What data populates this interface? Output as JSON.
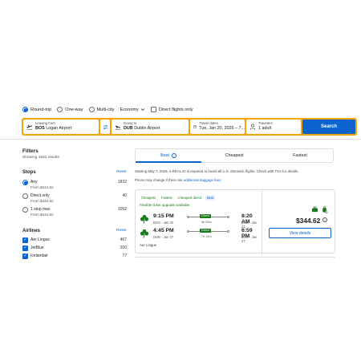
{
  "trip_types": {
    "round_trip": "Round-trip",
    "one_way": "One-way",
    "multi_city": "Multi-city",
    "cabin": "Economy",
    "direct_only": "Direct flights only"
  },
  "search": {
    "from_label": "Leaving from",
    "from_code": "BOS",
    "from_name": "Logan Airport",
    "to_label": "Going to",
    "to_code": "DUB",
    "to_name": "Dublin Airport",
    "dates_label": "Travel dates",
    "dates_value": "Tue, Jan 20, 2026 – 7...",
    "travelers_label": "Travelers",
    "travelers_value": "1 adult",
    "button": "Search"
  },
  "filters": {
    "title": "Filters",
    "count": "Showing 1832 results",
    "stops": {
      "title": "Stops",
      "reset": "Reset",
      "items": [
        {
          "name": "Any",
          "sub": "From $344.62",
          "count": "1832"
        },
        {
          "name": "Direct only",
          "sub": "From $344.62",
          "count": "40"
        },
        {
          "name": "1 stop max",
          "sub": "From $344.62",
          "count": "1052"
        }
      ]
    },
    "airlines": {
      "title": "Airlines",
      "reset": "Reset",
      "items": [
        {
          "name": "Aer Lingus",
          "count": "467"
        },
        {
          "name": "JetBlue",
          "count": "200"
        },
        {
          "name": "Icelandair",
          "count": "77"
        }
      ]
    }
  },
  "sort": {
    "tabs": [
      "Best",
      "Cheapest",
      "Fastest"
    ],
    "active": "Best"
  },
  "notices": {
    "real_id": "Starting May 7, 2025, a REAL ID is required to board all U.S. domestic flights. Check with TSA for details.",
    "baggage_prefix": "Prices may change if there are",
    "baggage_link": "additional baggage fees"
  },
  "flight": {
    "tags": [
      "Cheapest",
      "Fastest",
      "Cheapest direct",
      "Best"
    ],
    "flexible": "Flexible ticket upgrade available",
    "legs": [
      {
        "dep_time": "9:15 PM",
        "dep_sub": "BOS - Jan 20",
        "stops": "Direct",
        "duration": "6h 05m",
        "arr_time": "8:20 AM",
        "arr_sub": "DUB - Jan 21"
      },
      {
        "dep_time": "4:45 PM",
        "dep_sub": "DUB - Jan 27",
        "stops": "Direct",
        "duration": "7h 14m",
        "arr_time": "6:59 PM",
        "arr_sub": "BOS - Jan 27"
      }
    ],
    "airline": "Aer Lingus",
    "price": "$344.62",
    "view_button": "View details",
    "icons": [
      "carry-on-bag-icon",
      "checked-bag-icon"
    ],
    "brand_color": "#0b63ce",
    "accent_color": "#f4a500",
    "logo_color": "#1a7a1a"
  }
}
